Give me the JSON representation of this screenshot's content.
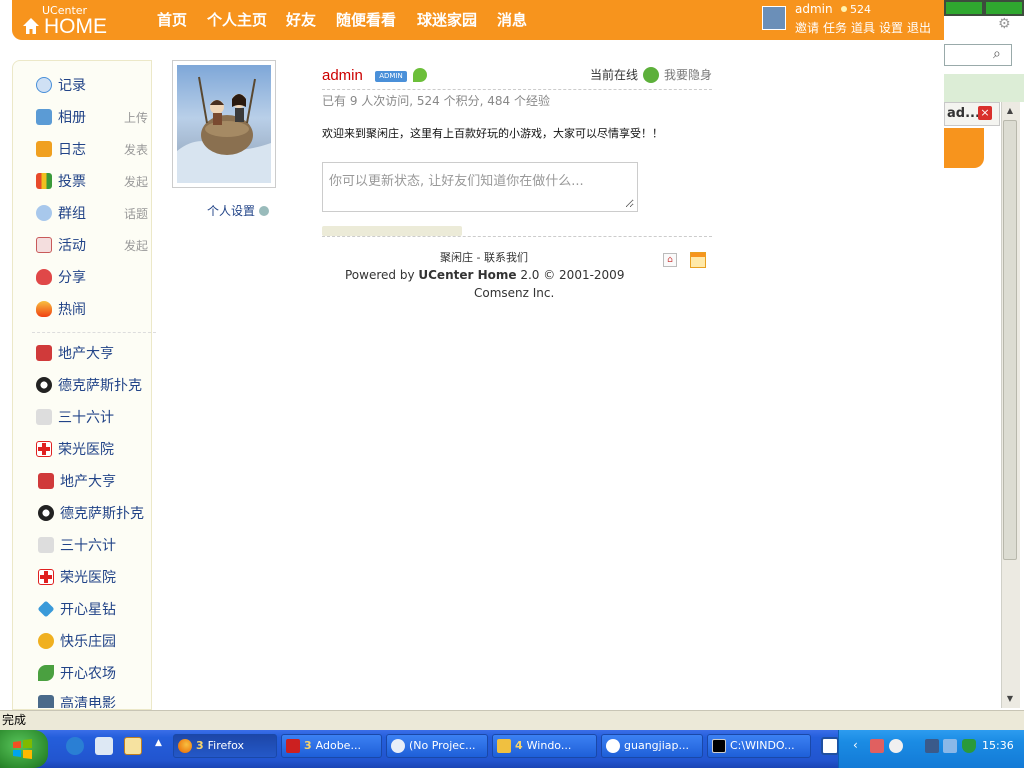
{
  "header": {
    "logo_small": "UCenter",
    "logo_big": "HOME",
    "nav": [
      "首页",
      "个人主页",
      "好友",
      "随便看看",
      "球迷家园",
      "消息"
    ],
    "user": "admin",
    "points": "524",
    "links": [
      "邀请",
      "任务",
      "道具",
      "设置",
      "退出"
    ]
  },
  "right_bg": {
    "tab_label": "ad...",
    "close": "×"
  },
  "sidebar": {
    "items": [
      {
        "label": "记录",
        "sub": "",
        "color": "#4a90d9"
      },
      {
        "label": "相册",
        "sub": "上传",
        "color": "#5b9bd5"
      },
      {
        "label": "日志",
        "sub": "发表",
        "color": "#f0a020"
      },
      {
        "label": "投票",
        "sub": "发起",
        "color": "#e84a2a"
      },
      {
        "label": "群组",
        "sub": "话题",
        "color": "#5a8fd0"
      },
      {
        "label": "活动",
        "sub": "发起",
        "color": "#c85a5a"
      },
      {
        "label": "分享",
        "sub": "",
        "color": "#e04848"
      },
      {
        "label": "热闹",
        "sub": "",
        "color": "#f06020"
      },
      {
        "label": "地产大亨",
        "sub": "",
        "color": "#d03a3a"
      },
      {
        "label": "德克萨斯扑克",
        "sub": "",
        "color": "#333333"
      },
      {
        "label": "三十六计",
        "sub": "",
        "color": "#555555"
      },
      {
        "label": "荣光医院",
        "sub": "",
        "color": "#e02020"
      },
      {
        "label": "地产大亨",
        "sub": "",
        "color": "#d03a3a"
      },
      {
        "label": "德克萨斯扑克",
        "sub": "",
        "color": "#333333"
      },
      {
        "label": "三十六计",
        "sub": "",
        "color": "#555555"
      },
      {
        "label": "荣光医院",
        "sub": "",
        "color": "#e02020"
      },
      {
        "label": "开心星钻",
        "sub": "",
        "color": "#3a9ad9"
      },
      {
        "label": "快乐庄园",
        "sub": "",
        "color": "#f0b020"
      },
      {
        "label": "开心农场",
        "sub": "",
        "color": "#4aa040"
      },
      {
        "label": "高清电影",
        "sub": "",
        "color": "#4a6a8a"
      }
    ]
  },
  "profile": {
    "settings_label": "个人设置",
    "username": "admin",
    "badge": "ADMIN",
    "online": "当前在线",
    "invisible": "我要隐身",
    "stats": "已有 9 人次访问, 524 个积分, 484 个经验",
    "welcome": "欢迎来到聚闲庄，这里有上百款好玩的小游戏，大家可以尽情享受！！",
    "status_placeholder": "你可以更新状态, 让好友们知道你在做什么..."
  },
  "footer": {
    "links": "聚闲庄 - 联系我们",
    "powered_prefix": "Powered by ",
    "powered_brand": "UCenter Home",
    "powered_suffix": " 2.0 © 2001-2009",
    "company": "Comsenz Inc."
  },
  "statusbar": {
    "text": "完成"
  },
  "taskbar": {
    "buttons": [
      {
        "num": "3",
        "label": "Firefox",
        "color": "#e66000"
      },
      {
        "num": "3",
        "label": "Adobe...",
        "color": "#cc2020"
      },
      {
        "num": "",
        "label": "(No Projec...",
        "color": "#dddddd"
      },
      {
        "num": "4",
        "label": "Windo...",
        "color": "#f0c040"
      },
      {
        "num": "",
        "label": "guangjiap...",
        "color": "#ffffff"
      },
      {
        "num": "",
        "label": "C:\\WINDO...",
        "color": "#000000"
      }
    ],
    "clock": "15:36"
  }
}
